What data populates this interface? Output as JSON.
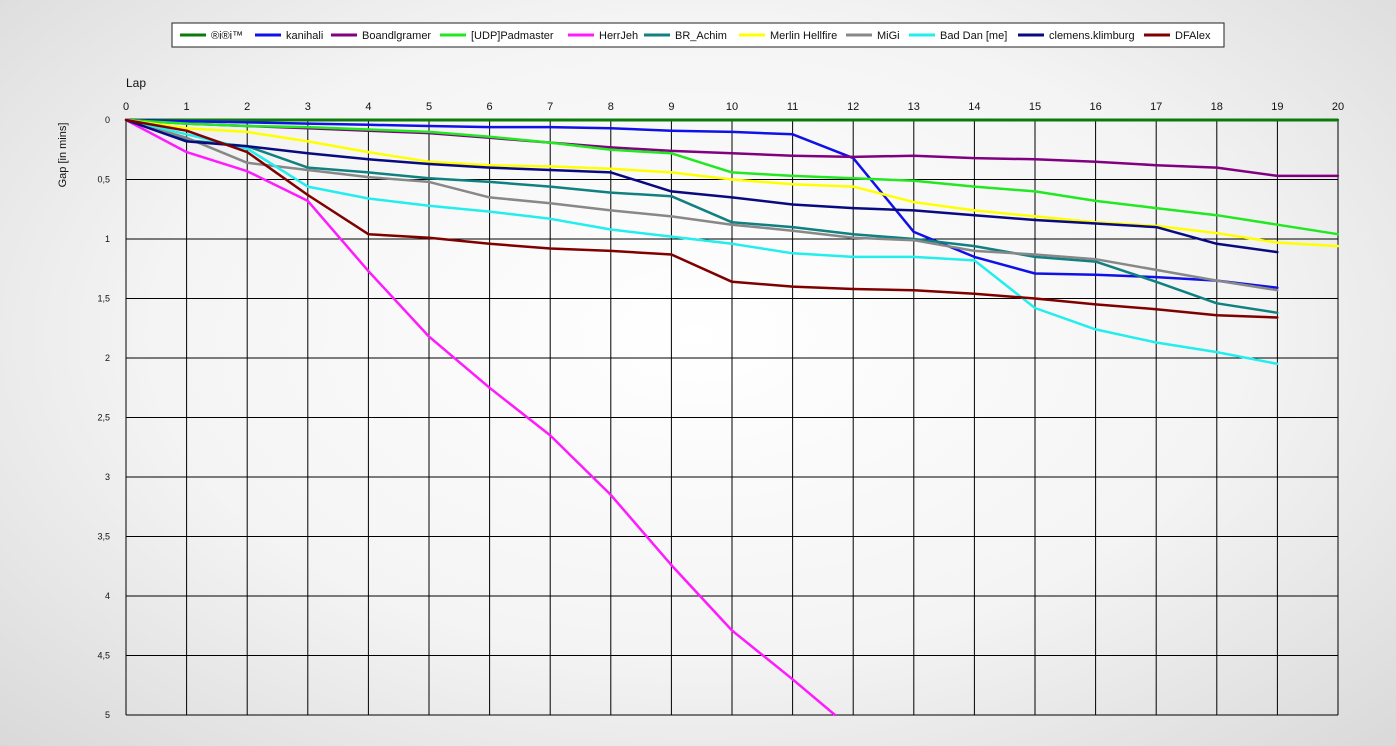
{
  "chart_data": {
    "type": "line",
    "xlabel": "Lap",
    "ylabel": "Gap [in mins]",
    "xlim": [
      0,
      20
    ],
    "ylim": [
      0,
      5
    ],
    "y_inverted": true,
    "grid": true,
    "legend_placement": "top",
    "x_ticks": [
      "0",
      "1",
      "2",
      "3",
      "4",
      "5",
      "6",
      "7",
      "8",
      "9",
      "10",
      "11",
      "12",
      "13",
      "14",
      "15",
      "16",
      "17",
      "18",
      "19",
      "20"
    ],
    "y_ticks": [
      {
        "v": 0,
        "label": "0"
      },
      {
        "v": 0.5,
        "label": "0,5"
      },
      {
        "v": 1,
        "label": "1"
      },
      {
        "v": 1.5,
        "label": "1,5"
      },
      {
        "v": 2,
        "label": "2"
      },
      {
        "v": 2.5,
        "label": "2,5"
      },
      {
        "v": 3,
        "label": "3"
      },
      {
        "v": 3.5,
        "label": "3,5"
      },
      {
        "v": 4,
        "label": "4"
      },
      {
        "v": 4.5,
        "label": "4,5"
      },
      {
        "v": 5,
        "label": "5"
      }
    ],
    "series": [
      {
        "name": "®i®i™",
        "color": "#0a7a0a",
        "x": [
          0,
          1,
          2,
          3,
          4,
          5,
          6,
          7,
          8,
          9,
          10,
          11,
          12,
          13,
          14,
          15,
          16,
          17,
          18,
          19,
          20
        ],
        "values": [
          0,
          0,
          0,
          0,
          0,
          0,
          0,
          0,
          0,
          0,
          0,
          0,
          0,
          0,
          0,
          0,
          0,
          0,
          0,
          0,
          0
        ]
      },
      {
        "name": "kanihali",
        "color": "#1010e8",
        "x": [
          0,
          1,
          2,
          3,
          4,
          5,
          6,
          7,
          8,
          9,
          10,
          11,
          12,
          13,
          14,
          15,
          16,
          17,
          18,
          19
        ],
        "values": [
          0,
          0.01,
          0.02,
          0.03,
          0.04,
          0.05,
          0.06,
          0.06,
          0.07,
          0.09,
          0.1,
          0.12,
          0.32,
          0.94,
          1.15,
          1.29,
          1.3,
          1.32,
          1.35,
          1.41
        ]
      },
      {
        "name": "Boandlgramer",
        "color": "#800080",
        "x": [
          0,
          1,
          2,
          3,
          4,
          5,
          6,
          7,
          8,
          9,
          10,
          11,
          12,
          13,
          14,
          15,
          16,
          17,
          18,
          19,
          20
        ],
        "values": [
          0,
          0.03,
          0.05,
          0.07,
          0.09,
          0.11,
          0.15,
          0.19,
          0.23,
          0.26,
          0.28,
          0.3,
          0.31,
          0.3,
          0.32,
          0.33,
          0.35,
          0.38,
          0.4,
          0.47,
          0.47
        ]
      },
      {
        "name": "[UDP]Padmaster",
        "color": "#22e822",
        "x": [
          0,
          1,
          2,
          3,
          4,
          5,
          6,
          7,
          8,
          9,
          10,
          11,
          12,
          13,
          14,
          15,
          16,
          17,
          18,
          19,
          20
        ],
        "values": [
          0,
          0.03,
          0.05,
          0.06,
          0.08,
          0.1,
          0.14,
          0.19,
          0.25,
          0.28,
          0.44,
          0.47,
          0.49,
          0.51,
          0.56,
          0.6,
          0.68,
          0.74,
          0.8,
          0.88,
          0.96
        ]
      },
      {
        "name": "HerrJeh",
        "color": "#ff1aff",
        "x": [
          0,
          1,
          2,
          3,
          4,
          5,
          6,
          7,
          8,
          9,
          10,
          11,
          11.7
        ],
        "values": [
          0,
          0.27,
          0.43,
          0.68,
          1.27,
          1.82,
          2.25,
          2.65,
          3.15,
          3.74,
          4.29,
          4.7,
          5
        ]
      },
      {
        "name": "BR_Achim",
        "color": "#108080",
        "x": [
          0,
          1,
          2,
          3,
          4,
          5,
          6,
          7,
          8,
          9,
          10,
          11,
          12,
          13,
          14,
          15,
          16,
          17,
          18,
          19
        ],
        "values": [
          0,
          0.17,
          0.22,
          0.4,
          0.44,
          0.49,
          0.52,
          0.56,
          0.61,
          0.64,
          0.86,
          0.9,
          0.96,
          1.0,
          1.06,
          1.15,
          1.19,
          1.36,
          1.54,
          1.62
        ]
      },
      {
        "name": "Merlin Hellfire",
        "color": "#ffff00",
        "x": [
          0,
          1,
          2,
          3,
          4,
          5,
          6,
          7,
          8,
          9,
          10,
          11,
          12,
          13,
          14,
          15,
          16,
          17,
          18,
          19,
          20
        ],
        "values": [
          0,
          0.07,
          0.1,
          0.18,
          0.27,
          0.35,
          0.38,
          0.39,
          0.41,
          0.44,
          0.5,
          0.54,
          0.56,
          0.69,
          0.76,
          0.81,
          0.86,
          0.89,
          0.95,
          1.03,
          1.06
        ]
      },
      {
        "name": "MiGi",
        "color": "#888888",
        "x": [
          0,
          1,
          2,
          3,
          4,
          5,
          6,
          7,
          8,
          9,
          10,
          11,
          12,
          13,
          14,
          15,
          16,
          17,
          18,
          19
        ],
        "values": [
          0,
          0.15,
          0.36,
          0.42,
          0.48,
          0.52,
          0.65,
          0.7,
          0.76,
          0.81,
          0.88,
          0.93,
          0.99,
          1.01,
          1.1,
          1.13,
          1.17,
          1.26,
          1.35,
          1.43
        ]
      },
      {
        "name": "Bad Dan [me]",
        "color": "#22eeee",
        "x": [
          0,
          1,
          2,
          3,
          4,
          5,
          6,
          7,
          8,
          9,
          10,
          11,
          12,
          13,
          14,
          15,
          16,
          17,
          18,
          19
        ],
        "values": [
          0,
          0.12,
          0.24,
          0.56,
          0.66,
          0.72,
          0.77,
          0.83,
          0.92,
          0.98,
          1.04,
          1.12,
          1.15,
          1.15,
          1.18,
          1.58,
          1.76,
          1.87,
          1.95,
          2.05
        ]
      },
      {
        "name": "clemens.klimburg",
        "color": "#0a0a80",
        "x": [
          0,
          1,
          2,
          3,
          4,
          5,
          6,
          7,
          8,
          9,
          10,
          11,
          12,
          13,
          14,
          15,
          16,
          17,
          18,
          19
        ],
        "values": [
          0,
          0.18,
          0.22,
          0.28,
          0.33,
          0.37,
          0.4,
          0.42,
          0.44,
          0.6,
          0.65,
          0.71,
          0.74,
          0.76,
          0.8,
          0.84,
          0.87,
          0.9,
          1.04,
          1.11
        ]
      },
      {
        "name": "DFAlex",
        "color": "#800000",
        "x": [
          0,
          1,
          2,
          3,
          4,
          5,
          6,
          7,
          8,
          9,
          10,
          11,
          12,
          13,
          14,
          15,
          16,
          17,
          18,
          19
        ],
        "values": [
          0,
          0.09,
          0.27,
          0.63,
          0.96,
          0.99,
          1.04,
          1.08,
          1.1,
          1.13,
          1.36,
          1.4,
          1.42,
          1.43,
          1.46,
          1.5,
          1.55,
          1.59,
          1.64,
          1.66
        ]
      }
    ]
  }
}
